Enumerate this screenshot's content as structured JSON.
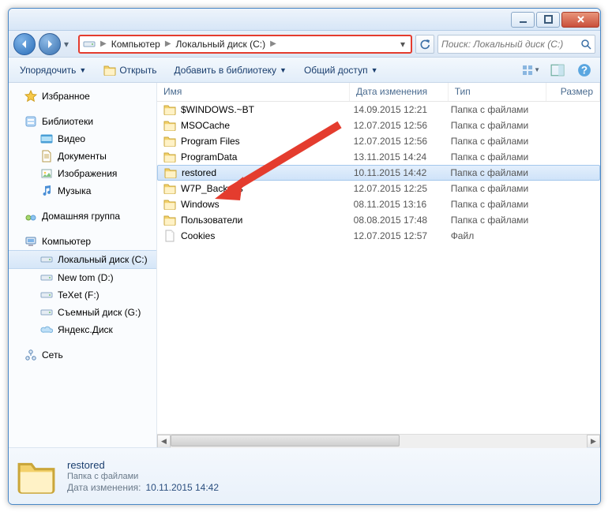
{
  "breadcrumbs": [
    "Компьютер",
    "Локальный диск (C:)"
  ],
  "search_placeholder": "Поиск: Локальный диск (C:)",
  "toolbar": {
    "organize": "Упорядочить",
    "open": "Открыть",
    "add_library": "Добавить в библиотеку",
    "share": "Общий доступ"
  },
  "columns": {
    "name": "Имя",
    "date": "Дата изменения",
    "type": "Тип",
    "size": "Размер"
  },
  "nav": {
    "favorites": "Избранное",
    "libraries": "Библиотеки",
    "lib_items": [
      "Видео",
      "Документы",
      "Изображения",
      "Музыка"
    ],
    "homegroup": "Домашняя группа",
    "computer": "Компьютер",
    "drives": [
      "Локальный диск (C:)",
      "New tom (D:)",
      "TeXet (F:)",
      "Съемный диск (G:)",
      "Яндекс.Диск"
    ],
    "network": "Сеть"
  },
  "files": [
    {
      "name": "$WINDOWS.~BT",
      "date": "14.09.2015 12:21",
      "type": "Папка с файлами",
      "icon": "folder"
    },
    {
      "name": "MSOCache",
      "date": "12.07.2015 12:56",
      "type": "Папка с файлами",
      "icon": "folder"
    },
    {
      "name": "Program Files",
      "date": "12.07.2015 12:56",
      "type": "Папка с файлами",
      "icon": "folder"
    },
    {
      "name": "ProgramData",
      "date": "13.11.2015 14:24",
      "type": "Папка с файлами",
      "icon": "folder"
    },
    {
      "name": "restored",
      "date": "10.11.2015 14:42",
      "type": "Папка с файлами",
      "icon": "folder",
      "selected": true
    },
    {
      "name": "W7P_Backups",
      "date": "12.07.2015 12:25",
      "type": "Папка с файлами",
      "icon": "folder"
    },
    {
      "name": "Windows",
      "date": "08.11.2015 13:16",
      "type": "Папка с файлами",
      "icon": "folder"
    },
    {
      "name": "Пользователи",
      "date": "08.08.2015 17:48",
      "type": "Папка с файлами",
      "icon": "folder"
    },
    {
      "name": "Cookies",
      "date": "12.07.2015 12:57",
      "type": "Файл",
      "icon": "file"
    }
  ],
  "details": {
    "name": "restored",
    "type": "Папка с файлами",
    "date_label": "Дата изменения:",
    "date": "10.11.2015 14:42"
  }
}
